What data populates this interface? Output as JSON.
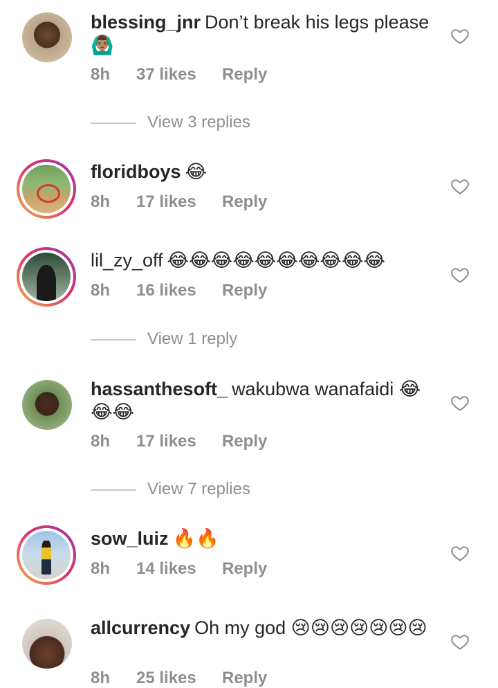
{
  "comments": [
    {
      "username": "blessing_jnr",
      "text": "Don’t break his legs please",
      "emojis": "🙆🏽‍♂️",
      "time": "8h",
      "likes": "37 likes",
      "reply": "Reply",
      "view_replies": "View 3 replies",
      "story_ring": false
    },
    {
      "username": "floridboys",
      "text": "",
      "emojis": "😂",
      "time": "8h",
      "likes": "17 likes",
      "reply": "Reply",
      "story_ring": true
    },
    {
      "username": "lil_zy_off",
      "text": "",
      "emojis": "😂😂😂😂😂😂😂😂😂😂",
      "time": "8h",
      "likes": "16 likes",
      "reply": "Reply",
      "view_replies": "View 1 reply",
      "story_ring": true
    },
    {
      "username": "hassanthesoft_",
      "text": "wakubwa wanafaidi",
      "emojis": "😂😂😂",
      "time": "8h",
      "likes": "17 likes",
      "reply": "Reply",
      "view_replies": "View 7 replies",
      "story_ring": false
    },
    {
      "username": "sow_luiz",
      "text": "",
      "emojis": "🔥🔥",
      "time": "8h",
      "likes": "14 likes",
      "reply": "Reply",
      "story_ring": true
    },
    {
      "username": "allcurrency",
      "text": "Oh my god",
      "emojis": "😢😢😢😢😢😢😢",
      "time": "8h",
      "likes": "25 likes",
      "reply": "Reply",
      "story_ring": false
    }
  ],
  "icons": {
    "like": "heart-outline-icon"
  },
  "colors": {
    "text_primary": "#262626",
    "text_secondary": "#8e8e8e",
    "divider": "#c7c7c7",
    "story_ring_start": "#f6b446",
    "story_ring_end": "#833ab4"
  }
}
